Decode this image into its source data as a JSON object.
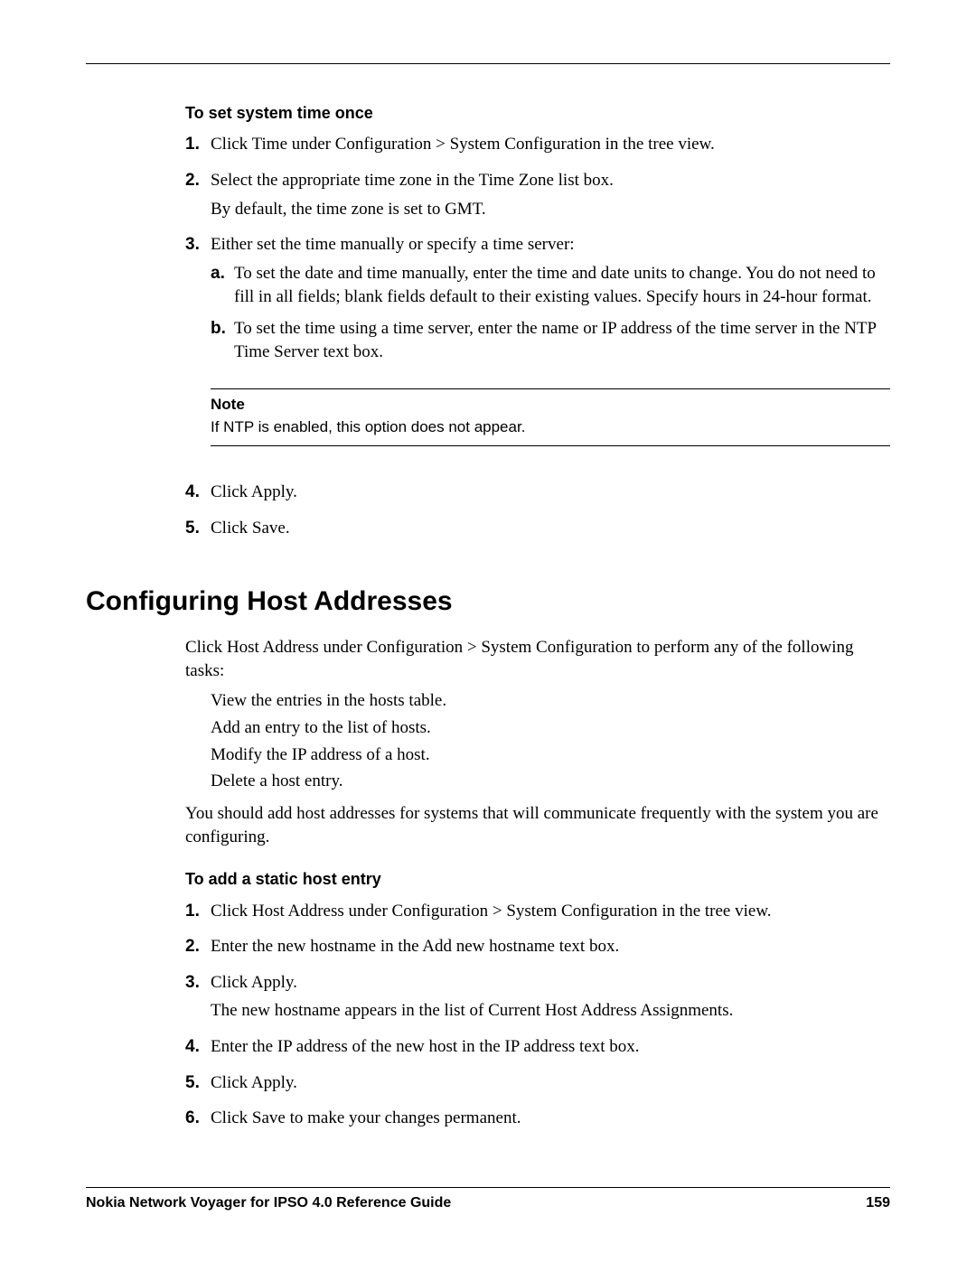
{
  "section1": {
    "title": "To set system time once",
    "steps": [
      {
        "marker": "1.",
        "text": "Click Time under Configuration > System Configuration in the tree view."
      },
      {
        "marker": "2.",
        "text": "Select the appropriate time zone in the Time Zone list box.",
        "extra": "By default, the time zone is set to GMT."
      },
      {
        "marker": "3.",
        "text": "Either set the time manually or specify a time server:",
        "sub": [
          {
            "marker": "a.",
            "text": "To set the date and time manually, enter the time and date units to change. You do not need to fill in all fields; blank fields default to their existing values. Specify hours in 24-hour format."
          },
          {
            "marker": "b.",
            "text": "To set the time using a time server, enter the name or IP address of the time server in the NTP Time Server text box."
          }
        ]
      },
      {
        "marker": "4.",
        "text": "Click Apply."
      },
      {
        "marker": "5.",
        "text": "Click Save."
      }
    ],
    "note": {
      "label": "Note",
      "text": "If NTP is enabled, this option does not appear."
    }
  },
  "section2": {
    "heading": "Configuring Host Addresses",
    "intro": "Click Host Address under Configuration > System Configuration to perform any of the following tasks:",
    "bullets": [
      "View the entries in the hosts table.",
      "Add an entry to the list of hosts.",
      "Modify the IP address of a host.",
      "Delete a host entry."
    ],
    "outro": "You should add host addresses for systems that will communicate frequently with the system you are configuring.",
    "subtitle": "To add a static host entry",
    "steps": [
      {
        "marker": "1.",
        "text": "Click Host Address under Configuration > System Configuration in the tree view."
      },
      {
        "marker": "2.",
        "text": "Enter the new hostname in the Add new hostname text box."
      },
      {
        "marker": "3.",
        "text": "Click Apply.",
        "extra": "The new hostname appears in the list of Current Host Address Assignments."
      },
      {
        "marker": "4.",
        "text": "Enter the IP address of the new host in the IP address text box."
      },
      {
        "marker": "5.",
        "text": "Click Apply."
      },
      {
        "marker": "6.",
        "text": "Click Save to make your changes permanent."
      }
    ]
  },
  "footer": {
    "title": "Nokia Network Voyager for IPSO 4.0 Reference Guide",
    "page": "159"
  }
}
